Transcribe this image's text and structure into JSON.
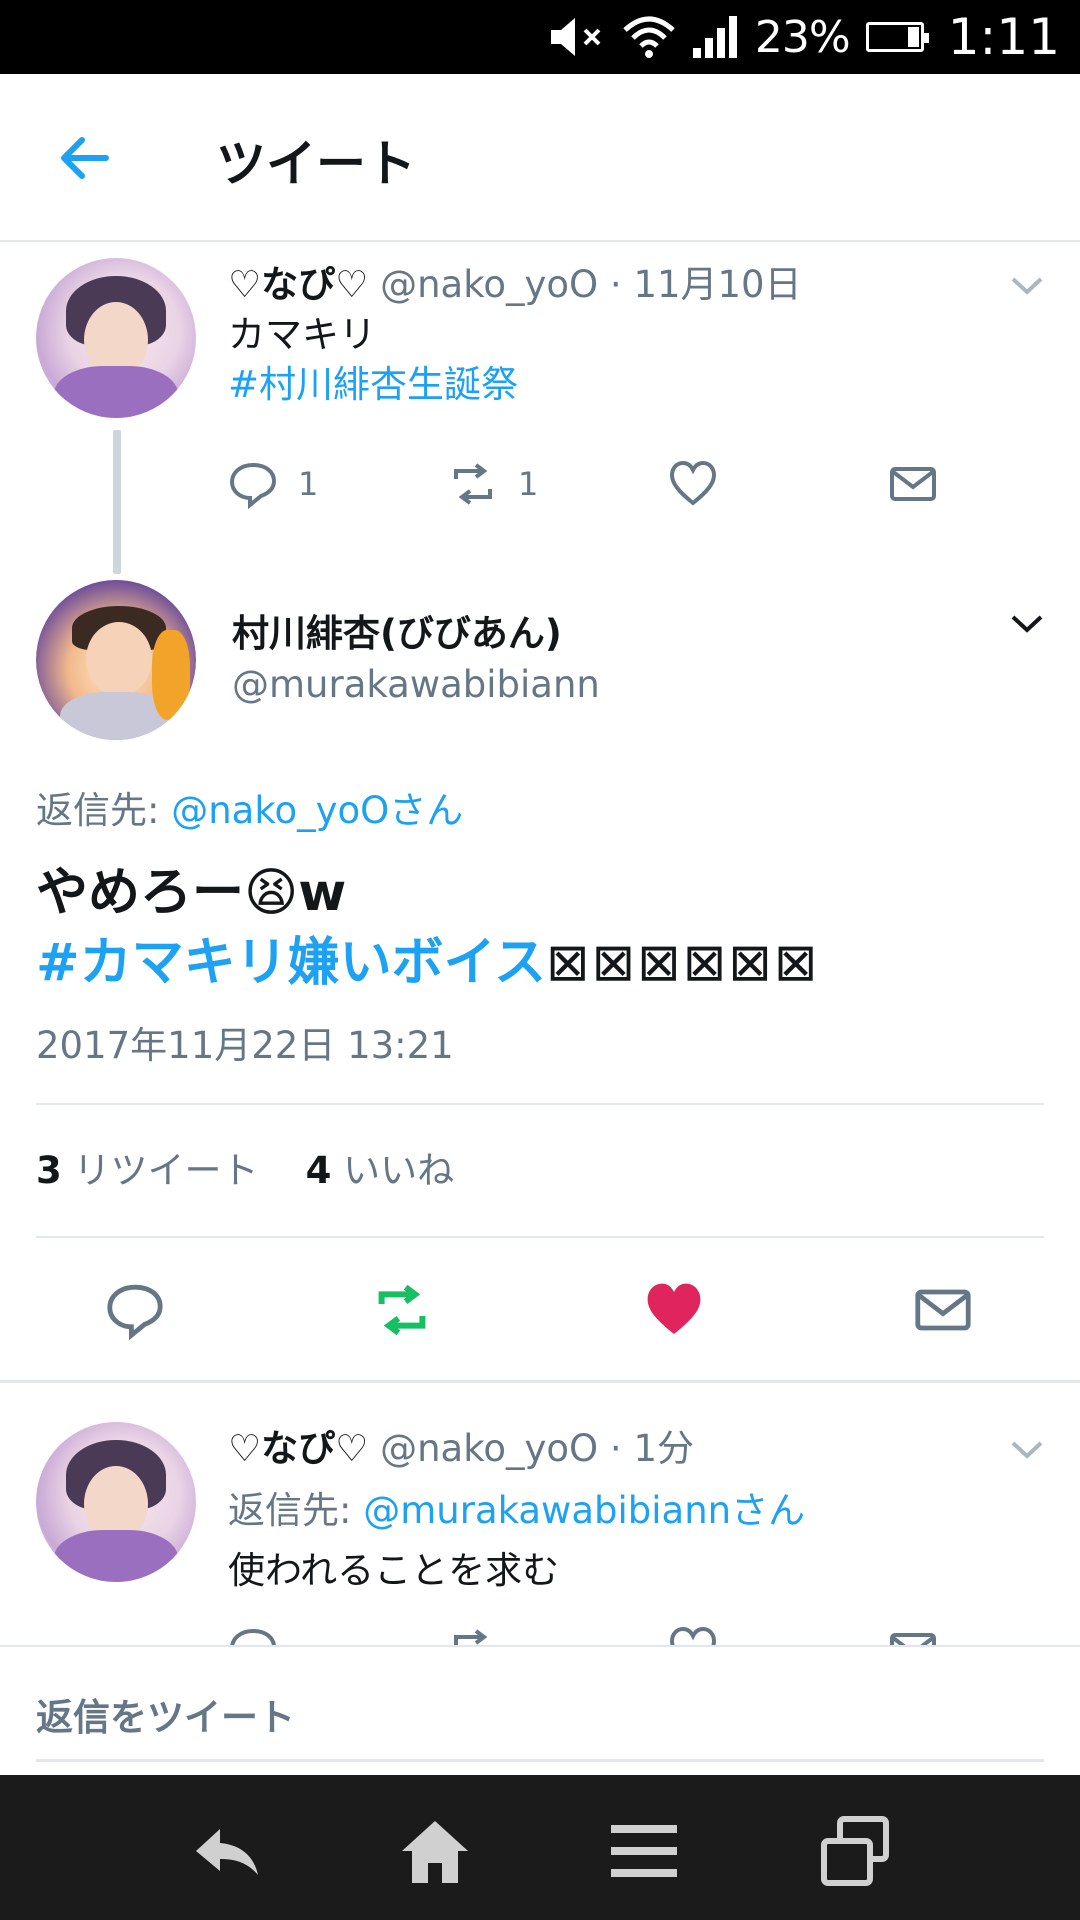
{
  "status_bar": {
    "battery_pct": "23%",
    "battery_level": 0.23,
    "time": "1:11"
  },
  "header": {
    "title": "ツイート"
  },
  "tweet1": {
    "name": "♡なぴ♡",
    "handle": "@nako_yoO",
    "time": "11月10日",
    "text": "カマキリ",
    "hashtag": "#村川緋杏生誕祭",
    "reply_count": "1",
    "retweet_count": "1"
  },
  "main_tweet": {
    "name": "村川緋杏(びびあん)",
    "handle": "@murakawabibiann",
    "reply_label": "返信先:",
    "reply_to": "@nako_yoOさん",
    "text_line1": "やめろー😫w",
    "hashtag": "#カマキリ嫌いボイス",
    "unsupported_glyphs": "⊠⊠⊠⊠⊠⊠",
    "date": "2017年11月22日 13:21",
    "retweets_count": "3",
    "retweets_label": "リツイート",
    "likes_count": "4",
    "likes_label": "いいね",
    "colors": {
      "retweet_active": "#17bf63",
      "like_active": "#e0245e"
    }
  },
  "tweet3": {
    "name": "♡なぴ♡",
    "handle": "@nako_yoO",
    "time": "1分",
    "reply_label": "返信先:",
    "reply_to": "@murakawabibiannさん",
    "text": "使われることを求む"
  },
  "reply_bar": {
    "placeholder": "返信をツイート"
  },
  "colors": {
    "link": "#1da1f2",
    "secondary": "#657786",
    "primary": "#14171a"
  }
}
